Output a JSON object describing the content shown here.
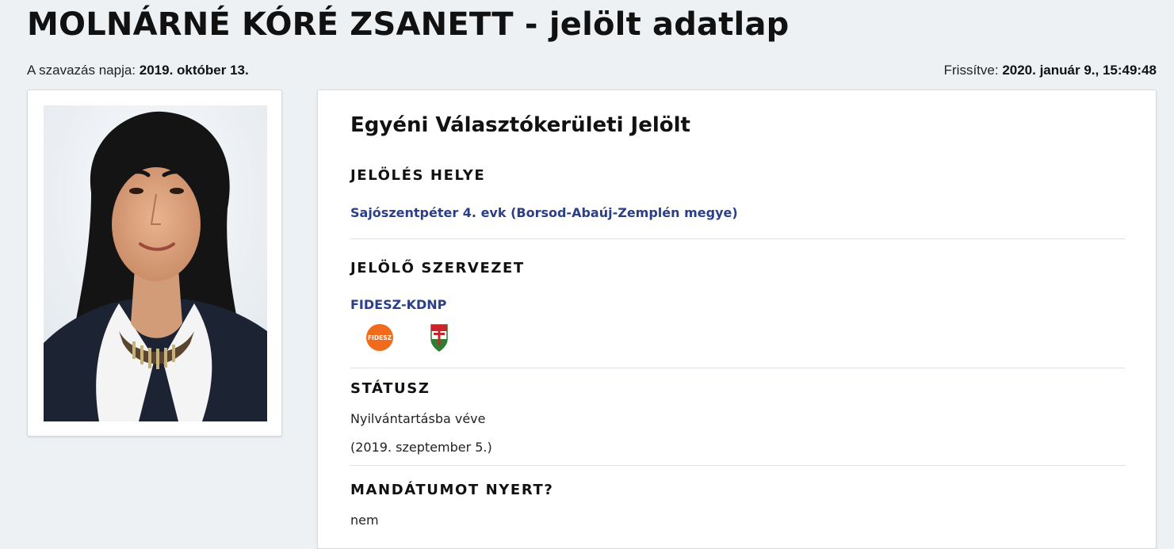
{
  "page": {
    "title": "MOLNÁRNÉ KÓRÉ ZSANETT - jelölt adatlap"
  },
  "meta": {
    "vote_label": "A szavazás napja:",
    "vote_date": "2019. október 13.",
    "updated_label": "Frissítve:",
    "updated_value": "2020. január 9., 15:49:48"
  },
  "candidate": {
    "heading": "Egyéni Választókerületi Jelölt",
    "sections": {
      "place_label": "JELÖLÉS HELYE",
      "place_value": "Sajószentpéter 4. evk (Borsod-Abaúj-Zemplén megye)",
      "org_label": "JELÖLŐ SZERVEZET",
      "org_value": "FIDESZ-KDNP",
      "status_label": "STÁTUSZ",
      "status_value": "Nyilvántartásba véve",
      "status_date": "(2019. szeptember 5.)",
      "mandate_label": "MANDÁTUMOT NYERT?",
      "mandate_value": "nem"
    }
  },
  "logos": {
    "fidesz_text": "FIDESZ",
    "fidesz_color": "#f26b1d",
    "kdnp_colors": [
      "#cc2229",
      "#ffffff",
      "#2e7d32"
    ]
  },
  "icons": {
    "fidesz": "fidesz-logo-icon",
    "kdnp": "kdnp-logo-icon"
  }
}
